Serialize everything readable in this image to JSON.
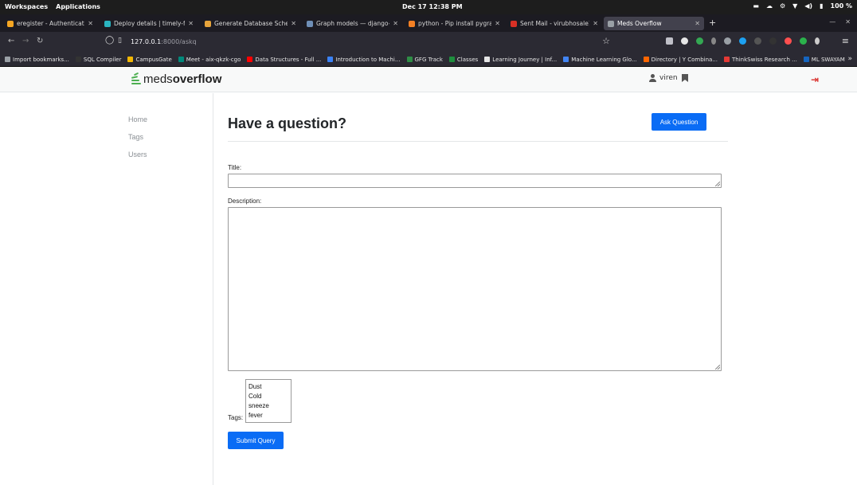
{
  "system_bar": {
    "workspaces": "Workspaces",
    "applications": "Applications",
    "clock": "Dec 17  12:38 PM",
    "battery": "100 %"
  },
  "tabs": [
    {
      "title": "eregister - Authentication",
      "color": "#f5a623",
      "active": false
    },
    {
      "title": "Deploy details | timely-flor",
      "color": "#2ab4c0",
      "active": false
    },
    {
      "title": "Generate Database Schema",
      "color": "#e7a43b",
      "active": false
    },
    {
      "title": "Graph models — django-ext",
      "color": "#6f8fb7",
      "active": false
    },
    {
      "title": "python - Pip install pygrap",
      "color": "#f48024",
      "active": false
    },
    {
      "title": "Sent Mail - virubhosale112@",
      "color": "#d93025",
      "active": false
    },
    {
      "title": "Meds Overflow",
      "color": "#9aa0a6",
      "active": true
    }
  ],
  "browser": {
    "url_host": "127.0.0.1",
    "url_rest": ":8000/askq"
  },
  "bookmarks": [
    {
      "label": "Import bookmarks...",
      "color": "#9aa0a6"
    },
    {
      "label": "SQL Compiler",
      "color": "#333333"
    },
    {
      "label": "CampusGate",
      "color": "#f2b705"
    },
    {
      "label": "Meet - aix-qkzk-cgo",
      "color": "#00897b"
    },
    {
      "label": "Data Structures - Full ...",
      "color": "#ff0000"
    },
    {
      "label": "Introduction to Machi...",
      "color": "#3b82f6"
    },
    {
      "label": "GFG Track",
      "color": "#2f8d46"
    },
    {
      "label": "Classes",
      "color": "#1e8e3e"
    },
    {
      "label": "Learning Journey | Inf...",
      "color": "#e6e6e6"
    },
    {
      "label": "Machine Learning Glo...",
      "color": "#4285f4"
    },
    {
      "label": "Directory | Y Combina...",
      "color": "#ff6600"
    },
    {
      "label": "ThinkSwiss Research ...",
      "color": "#e53935"
    },
    {
      "label": "ML SWAYAM",
      "color": "#1565c0"
    }
  ],
  "site": {
    "logo_prefix": "meds",
    "logo_suffix": "overflow",
    "username": "viren",
    "accent": "#0a6cf5"
  },
  "sidebar": {
    "items": [
      {
        "label": "Home"
      },
      {
        "label": "Tags"
      },
      {
        "label": "Users"
      }
    ]
  },
  "main": {
    "title": "Have a question?",
    "ask_button": "Ask Question",
    "title_label": "Title:",
    "description_label": "Description:",
    "tags_label": "Tags:",
    "tag_options": [
      "Dust",
      "Cold",
      "sneeze",
      "fever"
    ],
    "submit_button": "Submit Query"
  }
}
